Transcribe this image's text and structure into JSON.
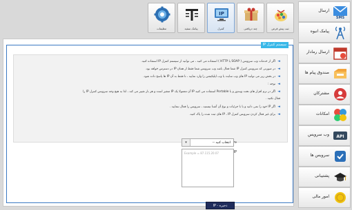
{
  "toolbar": {
    "buttons": [
      {
        "label": "تنظیمات",
        "icon": "gear-icon"
      },
      {
        "label": "پیامک سفید",
        "icon": "text-tool-icon"
      },
      {
        "label": "کنترل",
        "icon": "ip-monitor-icon"
      },
      {
        "label": "چند دریافتی",
        "icon": "gift-box-icon"
      },
      {
        "label": "ثبت پیش فرض",
        "icon": "candy-bag-icon"
      }
    ]
  },
  "panel": {
    "legend": "سیستم کنترل IP",
    "info_lines": [
      "اگر از خدمات وب سرویس ( SOAP یا HTTP ) استفاده می کنید ، می توانید از سیستم کنترل IP استفاده کنید.",
      "در صورتی که سرویس کنترل IP شما فعال باشد وب سرویس شما فقط از همان IP در دسترس خواهد بود.",
      "در بخش زیر می توانید IP های وب سایت یا وب اپلیکیشن را وارد نمایید ، تا فقط به آن IP ها پاسخ داده شود.",
      "توجه :",
      "اگر در نرم افزار های تحت ویندوز و یا Portable استفاده می کنید IP آن معمولا یک IP متغیر است و هر بار تغییر می کند ، لذا به هیچ وجه سرویس کنترل IP را",
      "فعال نکنید .",
      "اگر IP خود را نمی دانید و یا با جزئیات و نوع آن آشنا نیستید ، سرویس را فعال ننمایید .",
      "برای غیر فعال کردن سرویس کنترل IP ، IP های ثبت شده را پاک کنید."
    ],
    "status_label": "وضعیت فعلی سرویس کنترل IP :",
    "status_select_value": "انتخاب کنید --",
    "allowed_ips_label": "IP ها مجاز :",
    "allowed_ips_placeholder": "Example = 87.115.20.07",
    "submit_label": "ذخیره - IP"
  },
  "sidebar": {
    "items": [
      {
        "label": "ارسال",
        "icon": "sms-envelope-icon"
      },
      {
        "label": "پیامک انبوه",
        "icon": "antenna-icon"
      },
      {
        "label": "ارسال رمادار",
        "icon": "calendar-icon"
      },
      {
        "label": "صندوق پیام ها",
        "icon": "inbox-folder-icon"
      },
      {
        "label": "مشترکان",
        "icon": "contacts-icon"
      },
      {
        "label": "امکانات",
        "icon": "features-icon"
      },
      {
        "label": "وب سرویس",
        "icon": "api-icon"
      },
      {
        "label": "سرویس ها",
        "icon": "services-icon"
      },
      {
        "label": "پشتیبانی",
        "icon": "support-icon"
      },
      {
        "label": "امور مالی",
        "icon": "finance-icon"
      }
    ]
  }
}
